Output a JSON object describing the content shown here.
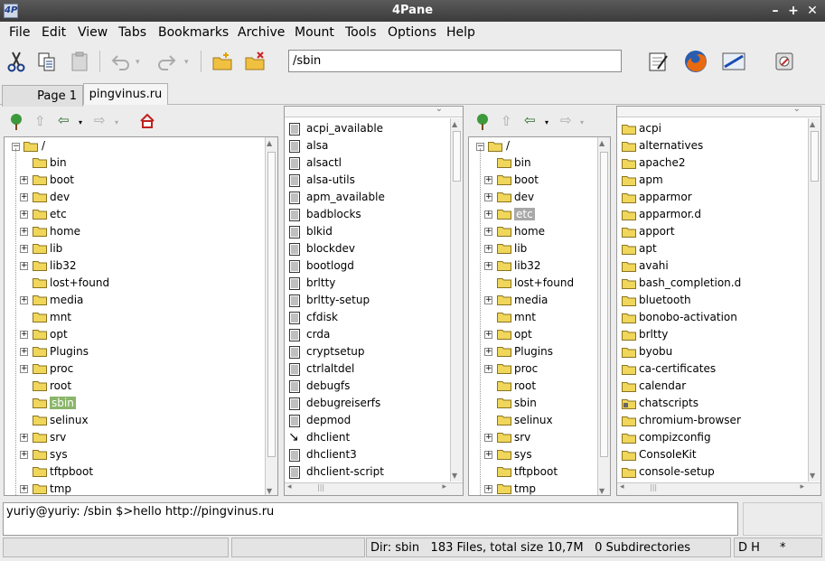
{
  "window": {
    "title": "4Pane",
    "app_icon": "4P"
  },
  "menu": [
    "File",
    "Edit",
    "View",
    "Tabs",
    "Bookmarks",
    "Archive",
    "Mount",
    "Tools",
    "Options",
    "Help"
  ],
  "toolbar": {
    "path_value": "/sbin"
  },
  "tabs": [
    {
      "label": "Page 1"
    },
    {
      "label": "pingvinus.ru"
    }
  ],
  "left_tree": {
    "root": "/",
    "items": [
      {
        "name": "bin",
        "expandable": false
      },
      {
        "name": "boot",
        "expandable": true
      },
      {
        "name": "dev",
        "expandable": true
      },
      {
        "name": "etc",
        "expandable": true
      },
      {
        "name": "home",
        "expandable": true
      },
      {
        "name": "lib",
        "expandable": true
      },
      {
        "name": "lib32",
        "expandable": true
      },
      {
        "name": "lost+found",
        "expandable": false
      },
      {
        "name": "media",
        "expandable": true
      },
      {
        "name": "mnt",
        "expandable": false
      },
      {
        "name": "opt",
        "expandable": true
      },
      {
        "name": "Plugins",
        "expandable": true
      },
      {
        "name": "proc",
        "expandable": true
      },
      {
        "name": "root",
        "expandable": false
      },
      {
        "name": "sbin",
        "expandable": false
      },
      {
        "name": "selinux",
        "expandable": false
      },
      {
        "name": "srv",
        "expandable": true
      },
      {
        "name": "sys",
        "expandable": true
      },
      {
        "name": "tftpboot",
        "expandable": false
      },
      {
        "name": "tmp",
        "expandable": true
      }
    ]
  },
  "left_files": [
    "acpi_available",
    "alsa",
    "alsactl",
    "alsa-utils",
    "apm_available",
    "badblocks",
    "blkid",
    "blockdev",
    "bootlogd",
    "brltty",
    "brltty-setup",
    "cfdisk",
    "crda",
    "cryptsetup",
    "ctrlaltdel",
    "debugfs",
    "debugreiserfs",
    "depmod",
    "dhclient",
    "dhclient3",
    "dhclient-script"
  ],
  "right_tree": {
    "root": "/",
    "items": [
      {
        "name": "bin",
        "expandable": false
      },
      {
        "name": "boot",
        "expandable": true
      },
      {
        "name": "dev",
        "expandable": true
      },
      {
        "name": "etc",
        "expandable": true
      },
      {
        "name": "home",
        "expandable": true
      },
      {
        "name": "lib",
        "expandable": true
      },
      {
        "name": "lib32",
        "expandable": true
      },
      {
        "name": "lost+found",
        "expandable": false
      },
      {
        "name": "media",
        "expandable": true
      },
      {
        "name": "mnt",
        "expandable": false
      },
      {
        "name": "opt",
        "expandable": true
      },
      {
        "name": "Plugins",
        "expandable": true
      },
      {
        "name": "proc",
        "expandable": true
      },
      {
        "name": "root",
        "expandable": false
      },
      {
        "name": "sbin",
        "expandable": false
      },
      {
        "name": "selinux",
        "expandable": false
      },
      {
        "name": "srv",
        "expandable": true
      },
      {
        "name": "sys",
        "expandable": true
      },
      {
        "name": "tftpboot",
        "expandable": false
      },
      {
        "name": "tmp",
        "expandable": true
      }
    ]
  },
  "right_files": [
    "acpi",
    "alternatives",
    "apache2",
    "apm",
    "apparmor",
    "apparmor.d",
    "apport",
    "apt",
    "avahi",
    "bash_completion.d",
    "bluetooth",
    "bonobo-activation",
    "brltty",
    "byobu",
    "ca-certificates",
    "calendar",
    "chatscripts",
    "chromium-browser",
    "compizconfig",
    "ConsoleKit",
    "console-setup"
  ],
  "terminal": {
    "line": "yuriy@yuriy: /sbin $>hello http://pingvinus.ru"
  },
  "status": {
    "dir": "Dir: sbin",
    "summary": "183 Files, total size 10,7M",
    "subdirs": "0 Subdirectories",
    "flags": "D H",
    "star": "*"
  },
  "colors": {
    "selection_green": "#8ab56a",
    "selection_gray": "#a8a8a8",
    "folder": "#f0d65a"
  }
}
